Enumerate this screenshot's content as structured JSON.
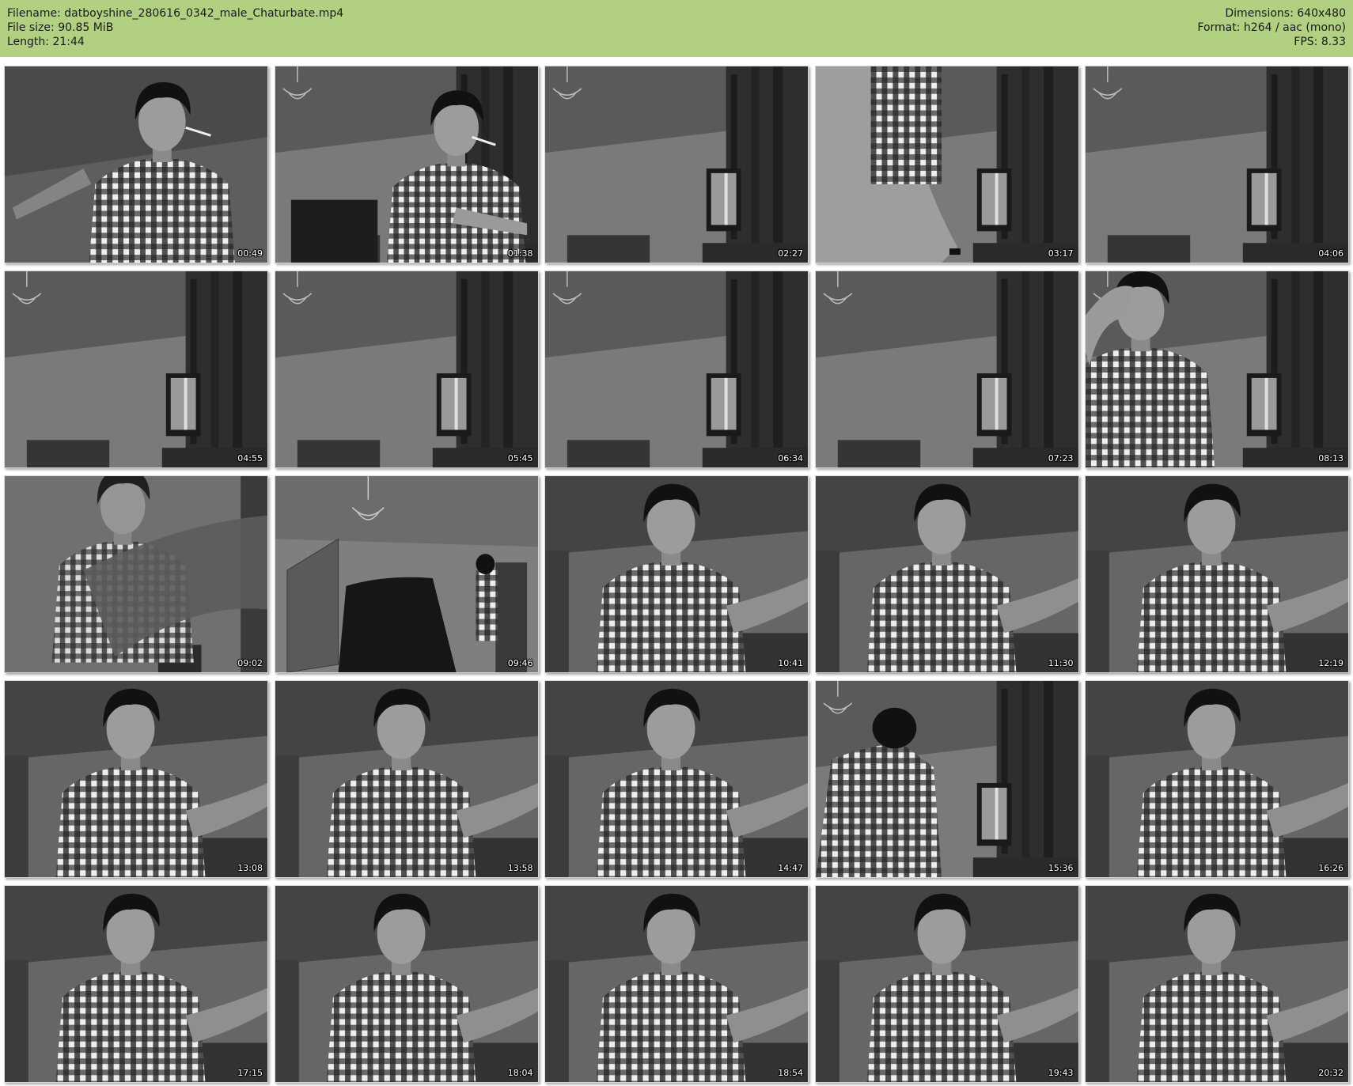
{
  "header": {
    "filename": "Filename: datboyshine_280616_0342_male_Chaturbate.mp4",
    "filesize": "File size: 90.85 MiB",
    "length": "Length: 21:44",
    "dimensions": "Dimensions: 640x480",
    "format": "Format: h264 / aac (mono)",
    "fps": "FPS: 8.33"
  },
  "colors": {
    "header_bg": "#b2d082",
    "page_bg": "#ffffff"
  },
  "thumbnails": [
    {
      "time": "00:49",
      "scene": "person-wide"
    },
    {
      "time": "01:38",
      "scene": "person-side"
    },
    {
      "time": "02:27",
      "scene": "empty-room"
    },
    {
      "time": "03:17",
      "scene": "arm-closeup"
    },
    {
      "time": "04:06",
      "scene": "empty-room"
    },
    {
      "time": "04:55",
      "scene": "empty-room"
    },
    {
      "time": "05:45",
      "scene": "empty-room"
    },
    {
      "time": "06:34",
      "scene": "empty-room"
    },
    {
      "time": "07:23",
      "scene": "empty-room"
    },
    {
      "time": "08:13",
      "scene": "person-left"
    },
    {
      "time": "09:02",
      "scene": "blur"
    },
    {
      "time": "09:46",
      "scene": "room-chair"
    },
    {
      "time": "10:41",
      "scene": "person-center"
    },
    {
      "time": "11:30",
      "scene": "person-center"
    },
    {
      "time": "12:19",
      "scene": "person-center"
    },
    {
      "time": "13:08",
      "scene": "person-center"
    },
    {
      "time": "13:58",
      "scene": "person-center"
    },
    {
      "time": "14:47",
      "scene": "person-center"
    },
    {
      "time": "15:36",
      "scene": "person-away"
    },
    {
      "time": "16:26",
      "scene": "person-center"
    },
    {
      "time": "17:15",
      "scene": "person-center"
    },
    {
      "time": "18:04",
      "scene": "person-center"
    },
    {
      "time": "18:54",
      "scene": "person-center"
    },
    {
      "time": "19:43",
      "scene": "person-center"
    },
    {
      "time": "20:32",
      "scene": "person-center"
    }
  ]
}
